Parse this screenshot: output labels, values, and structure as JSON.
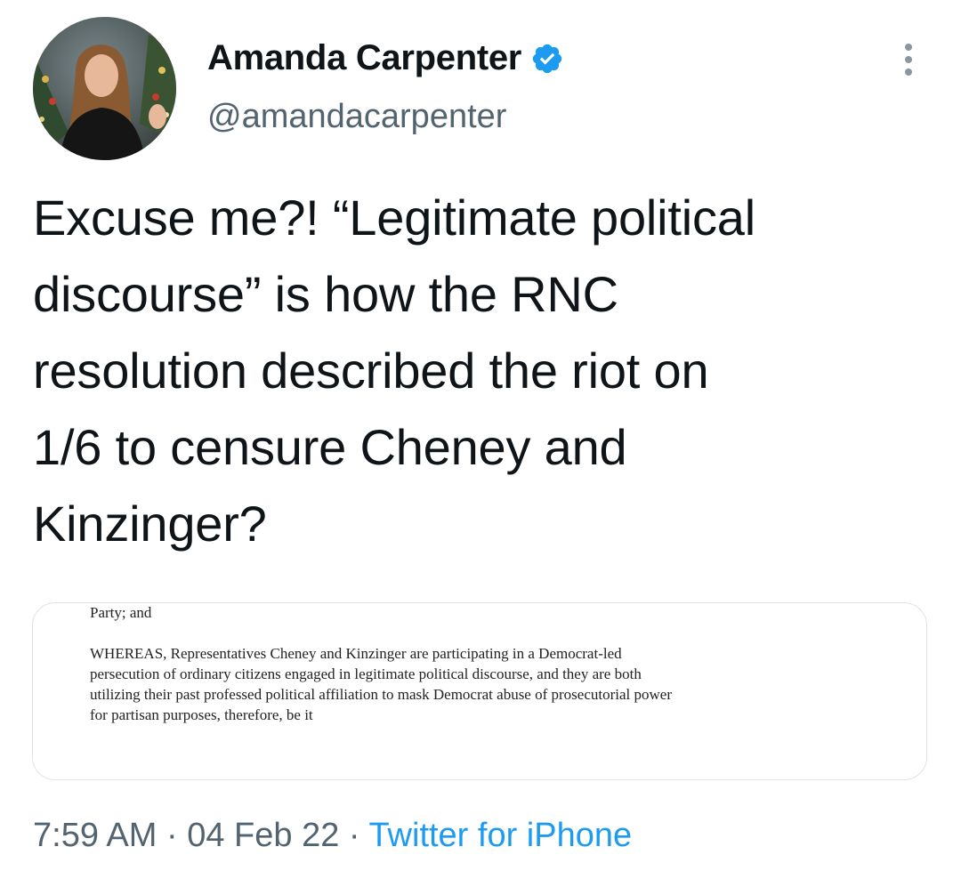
{
  "author": {
    "display_name": "Amanda Carpenter",
    "handle": "@amandacarpenter",
    "verified_icon": "verified-badge-icon"
  },
  "tweet": {
    "text": "Excuse me?! “Legitimate political discourse” is how the RNC resolution described the riot on 1/6 to censure Cheney and Kinzinger?",
    "lines": [
      "Excuse me?! “Legitimate political",
      "discourse” is how the RNC",
      "resolution described the riot on",
      "1/6 to censure Cheney and",
      "Kinzinger?"
    ]
  },
  "media": {
    "doc_lines": [
      "Party; and",
      "WHEREAS, Representatives Cheney and Kinzinger are participating in a Democrat-led",
      "persecution of ordinary citizens engaged in legitimate political discourse, and they are both",
      "utilizing their past professed political affiliation to mask Democrat abuse of prosecutorial power",
      "for partisan purposes, therefore, be it"
    ]
  },
  "meta": {
    "time": "7:59 AM",
    "separator": " · ",
    "date": "04 Feb 22",
    "source": "Twitter for iPhone"
  },
  "colors": {
    "text": "#0f1419",
    "secondary": "#536471",
    "accent": "#1d9bf0",
    "card_border": "#dfe3e6"
  }
}
